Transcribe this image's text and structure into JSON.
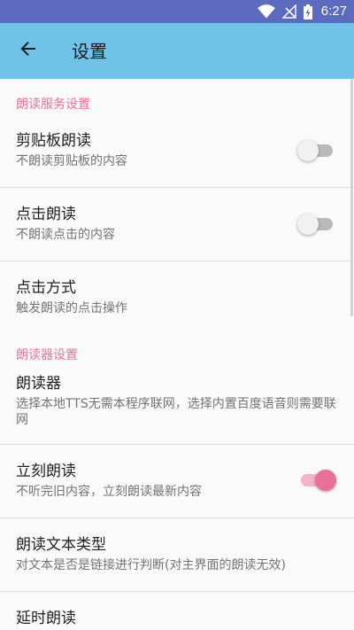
{
  "status_bar": {
    "time": "6:27",
    "icons": [
      "wifi-icon",
      "signal-off-icon",
      "battery-charging-icon"
    ]
  },
  "app_bar": {
    "back_icon": "arrow-back-icon",
    "title": "设置"
  },
  "sections": {
    "reading_service": {
      "header": "朗读服务设置"
    },
    "reader": {
      "header": "朗读器设置"
    }
  },
  "prefs": {
    "clipboard": {
      "title": "剪贴板朗读",
      "summary": "不朗读剪贴板的内容",
      "switch_on": false
    },
    "click_read": {
      "title": "点击朗读",
      "summary": "不朗读点击的内容",
      "switch_on": false
    },
    "click_mode": {
      "title": "点击方式",
      "summary": "触发朗读的点击操作"
    },
    "reader": {
      "title": "朗读器",
      "summary": "选择本地TTS无需本程序联网，选择内置百度语音则需要联网"
    },
    "immediate": {
      "title": "立刻朗读",
      "summary": "不听完旧内容，立刻朗读最新内容",
      "switch_on": true
    },
    "text_type": {
      "title": "朗读文本类型",
      "summary": "对文本是否是链接进行判断(对主界面的朗读无效)"
    },
    "delayed": {
      "title": "延时朗读"
    }
  },
  "colors": {
    "status_bar": "#5c6bc0",
    "app_bar": "#6ec3e6",
    "accent": "#ec6f9a",
    "background": "#fafafa"
  }
}
